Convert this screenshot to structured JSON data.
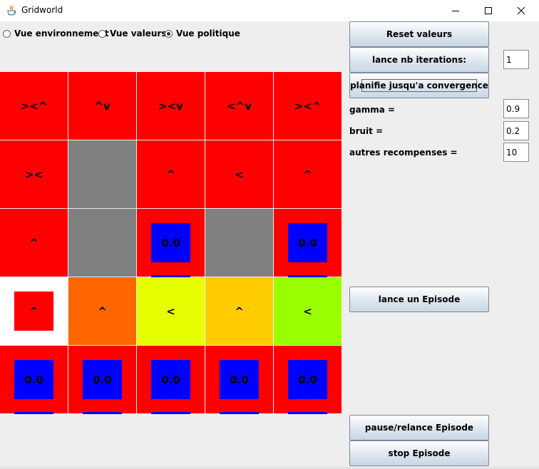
{
  "window": {
    "title": "Gridworld"
  },
  "views": [
    {
      "label": "Vue environnement",
      "checked": false
    },
    {
      "label": "Vue valeurs",
      "checked": false
    },
    {
      "label": "Vue politique",
      "checked": true
    }
  ],
  "colors": {
    "red": "#ff0000",
    "gray": "#808080",
    "blue": "#0000ff",
    "white": "#ffffff",
    "orange": "#ff6600",
    "yellow_green": "#e6ff00",
    "amber": "#ffcc00",
    "lime": "#99ff00"
  },
  "grid": {
    "rows": [
      [
        {
          "bg": "#ff0000",
          "text": "><^"
        },
        {
          "bg": "#ff0000",
          "text": "^v"
        },
        {
          "bg": "#ff0000",
          "text": "><v"
        },
        {
          "bg": "#ff0000",
          "text": "<^v"
        },
        {
          "bg": "#ff0000",
          "text": "><^"
        }
      ],
      [
        {
          "bg": "#ff0000",
          "text": "><"
        },
        {
          "bg": "#808080",
          "text": ""
        },
        {
          "bg": "#ff0000",
          "text": "^"
        },
        {
          "bg": "#ff0000",
          "text": "<"
        },
        {
          "bg": "#ff0000",
          "text": "^"
        }
      ],
      [
        {
          "bg": "#ff0000",
          "text": "^"
        },
        {
          "bg": "#808080",
          "text": ""
        },
        {
          "bg": "#ff0000",
          "box": "#0000ff",
          "text": "0.0"
        },
        {
          "bg": "#808080",
          "text": ""
        },
        {
          "bg": "#ff0000",
          "box": "#0000ff",
          "text": "0.0"
        }
      ],
      [
        {
          "bg": "#ffffff",
          "box": "#ff0000",
          "text": "^"
        },
        {
          "bg": "#ff6600",
          "text": "^"
        },
        {
          "bg": "#e6ff00",
          "text": "<"
        },
        {
          "bg": "#ffcc00",
          "text": "^"
        },
        {
          "bg": "#99ff00",
          "text": "<"
        }
      ],
      [
        {
          "bg": "#ff0000",
          "box": "#0000ff",
          "text": "0.0"
        },
        {
          "bg": "#ff0000",
          "box": "#0000ff",
          "text": "0.0"
        },
        {
          "bg": "#ff0000",
          "box": "#0000ff",
          "text": "0.0"
        },
        {
          "bg": "#ff0000",
          "box": "#0000ff",
          "text": "0.0"
        },
        {
          "bg": "#ff0000",
          "box": "#0000ff",
          "text": "0.0"
        }
      ]
    ]
  },
  "controls": {
    "reset_label": "Reset valeurs",
    "iterations_label": "lance nb iterations:",
    "iterations_value": "1",
    "converge_label": "planifie jusqu'a convergence",
    "gamma_label": "gamma =",
    "gamma_value": "0.9",
    "noise_label": "bruit =",
    "noise_value": "0.2",
    "other_rewards_label": "autres recompenses =",
    "other_rewards_value": "10",
    "episode_label": "lance un Episode",
    "pause_label": "pause/relance Episode",
    "stop_label": "stop Episode"
  }
}
